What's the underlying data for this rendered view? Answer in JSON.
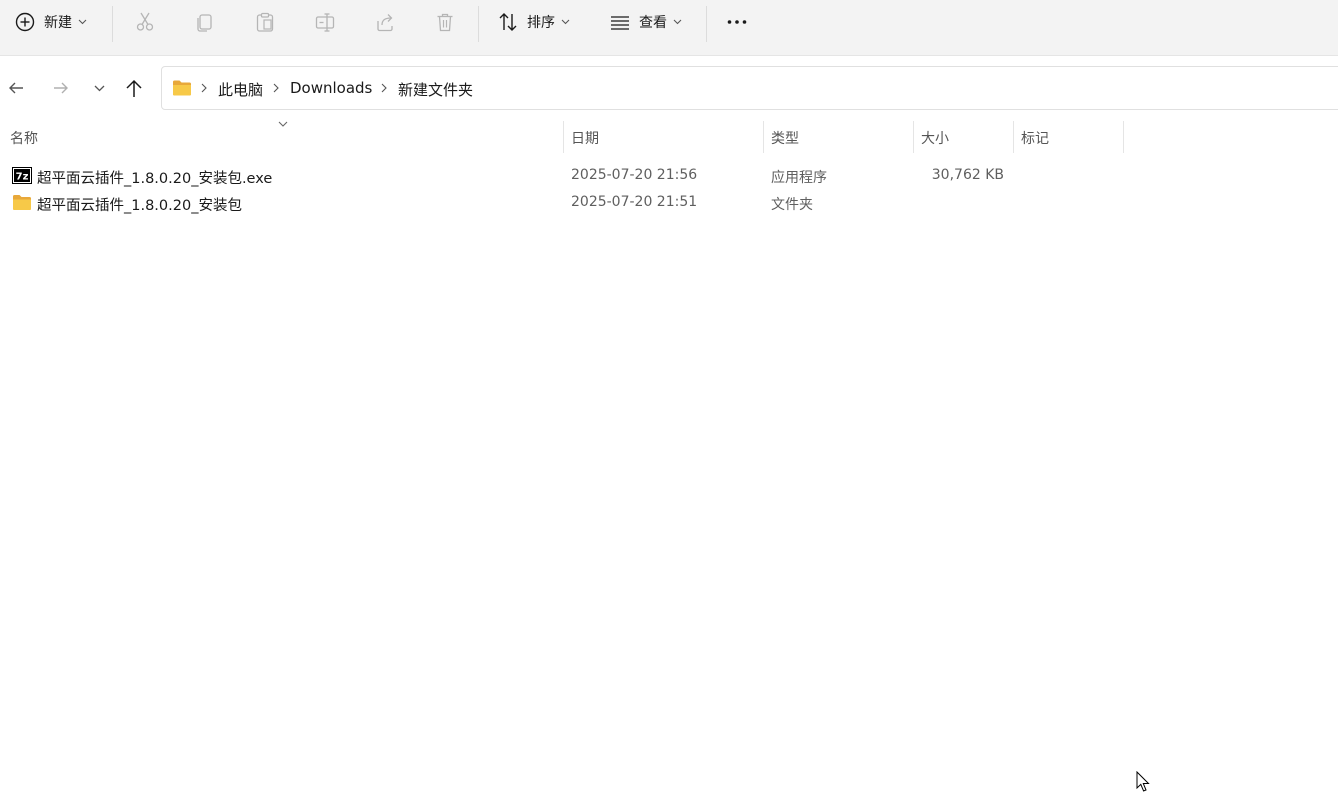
{
  "toolbar": {
    "new_label": "新建",
    "sort_label": "排序",
    "view_label": "查看"
  },
  "breadcrumb": {
    "items": [
      "此电脑",
      "Downloads",
      "新建文件夹"
    ]
  },
  "columns": {
    "name": "名称",
    "date": "日期",
    "type": "类型",
    "size": "大小",
    "tags": "标记"
  },
  "files": [
    {
      "name": "超平面云插件_1.8.0.20_安装包.exe",
      "date": "2025-07-20 21:56",
      "type": "应用程序",
      "size": "30,762 KB",
      "icon": "7zip-exe-icon"
    },
    {
      "name": "超平面云插件_1.8.0.20_安装包",
      "date": "2025-07-20 21:51",
      "type": "文件夹",
      "size": "",
      "icon": "folder-icon"
    }
  ],
  "colors": {
    "toolbar_bg": "#f3f3f3",
    "folder": "#f7c948",
    "text": "#1a1a1a",
    "muted": "#5f5f5f"
  }
}
